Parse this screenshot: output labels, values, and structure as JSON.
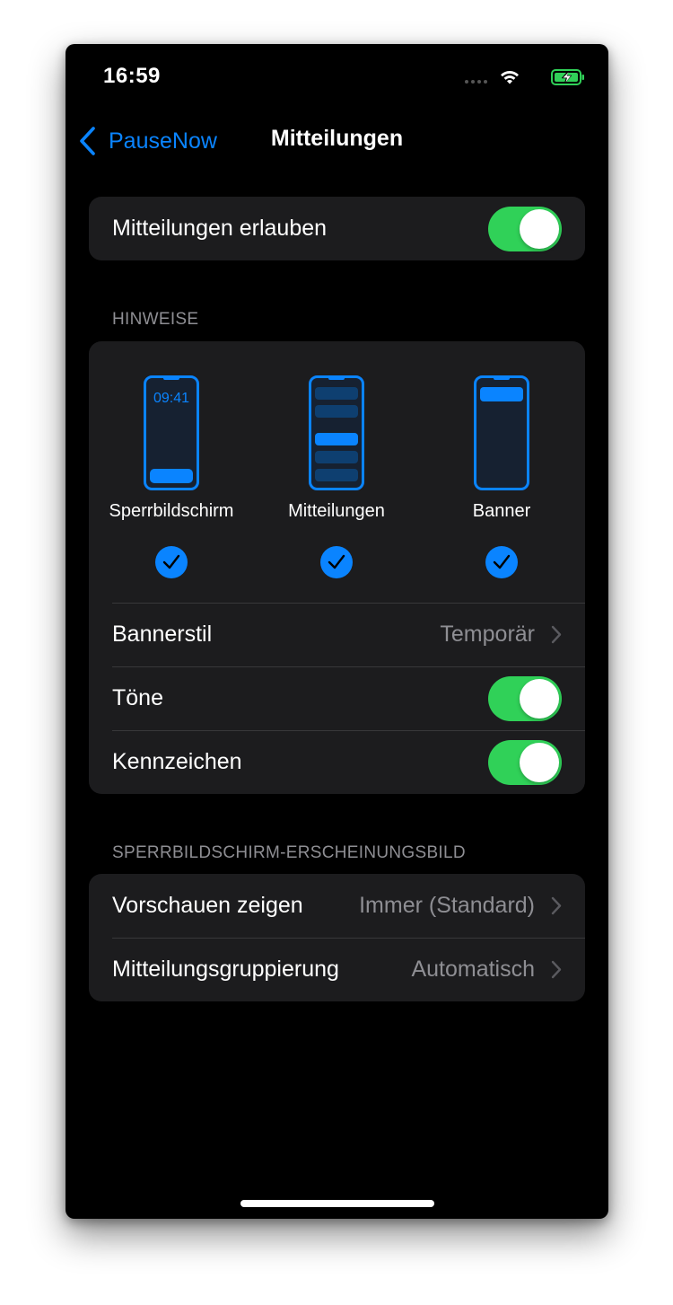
{
  "status_bar": {
    "time": "16:59",
    "icons": [
      "signal-icon",
      "wifi-icon",
      "battery-charging-icon"
    ]
  },
  "nav": {
    "back_label": "PauseNow",
    "title": "Mitteilungen",
    "back_icon": "chevron-left-icon"
  },
  "allow": {
    "label": "Mitteilungen erlauben",
    "enabled": true
  },
  "alerts": {
    "header": "HINWEISE",
    "options": [
      {
        "label": "Sperrbildschirm",
        "preview_time": "09:41",
        "checked": true
      },
      {
        "label": "Mitteilungen",
        "checked": true
      },
      {
        "label": "Banner",
        "checked": true
      }
    ],
    "rows": [
      {
        "label": "Bannerstil",
        "value": "Temporär"
      },
      {
        "label": "Töne",
        "enabled": true
      },
      {
        "label": "Kennzeichen",
        "enabled": true
      }
    ]
  },
  "lockscreen": {
    "header": "SPERRBILDSCHIRM-ERSCHEINUNGSBILD",
    "rows": [
      {
        "label": "Vorschauen zeigen",
        "value": "Immer (Standard)"
      },
      {
        "label": "Mitteilungsgruppierung",
        "value": "Automatisch"
      }
    ]
  },
  "colors": {
    "accent": "#0a84ff",
    "toggle_on": "#30d158",
    "group_bg": "#1c1c1e",
    "secondary_text": "#8e8e93"
  }
}
